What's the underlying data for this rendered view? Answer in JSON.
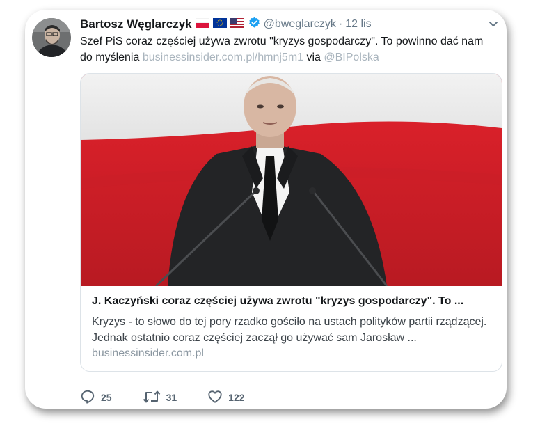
{
  "tweet": {
    "author_name": "Bartosz Węglarczyk",
    "handle": "@bweglarczyk",
    "separator": "·",
    "date": "12 lis",
    "text_main": "Szef PiS coraz częściej używa zwrotu \"kryzys gospodarczy\". To powinno dać nam do myślenia ",
    "text_link": "businessinsider.com.pl/hmnj5m1",
    "text_via": " via ",
    "text_mention": "@BIPolska"
  },
  "card": {
    "title": "J. Kaczyński coraz częściej używa zwrotu \"kryzys gospodarczy\". To ...",
    "description": "Kryzys - to słowo do tej pory rzadko gościło na ustach polityków partii rządzącej. Jednak ostatnio coraz częściej zaczął go używać sam Jarosław ...",
    "domain": "businessinsider.com.pl"
  },
  "actions": {
    "replies": "25",
    "retweets": "31",
    "likes": "122"
  },
  "colors": {
    "text": "#14171a",
    "muted": "#657786",
    "link": "#a9b4bd",
    "verified": "#1da1f2",
    "flag_red": "#dc143c"
  },
  "icons": {
    "flags": [
      "poland-flag-icon",
      "eu-flag-icon",
      "usa-flag-icon"
    ],
    "verified": "verified-badge-icon",
    "menu": "chevron-down-icon",
    "reply": "reply-icon",
    "retweet": "retweet-icon",
    "like": "heart-icon"
  }
}
